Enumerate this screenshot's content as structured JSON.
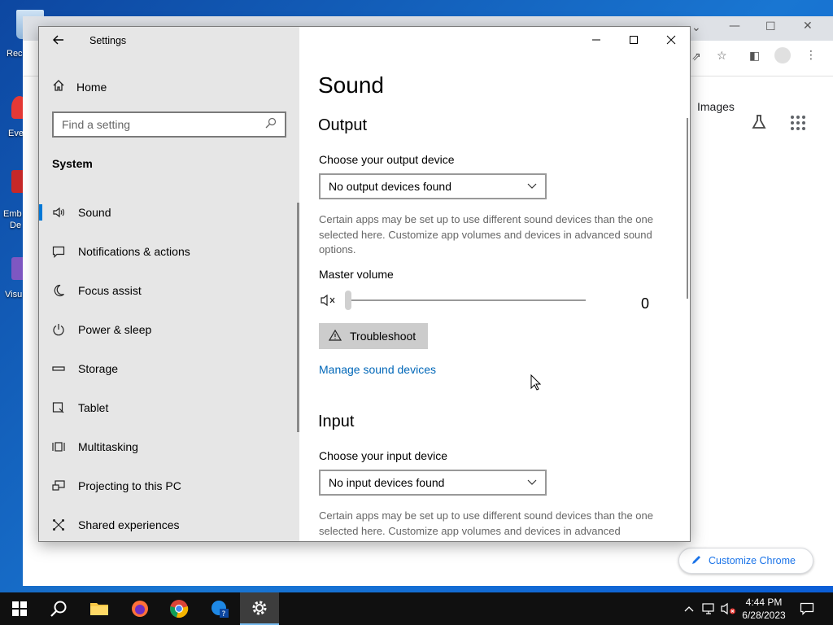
{
  "desktop": {
    "icons": [
      {
        "label": "Rec",
        "color": "#9ec5e8"
      },
      {
        "label": "Eve",
        "color": "#e53935"
      },
      {
        "label": "Emb",
        "label2": "De",
        "color": "#c62828"
      },
      {
        "label": "Visu",
        "color": "#7e57c2"
      }
    ]
  },
  "chrome": {
    "images_label": "Images",
    "customize_label": "Customize Chrome"
  },
  "settings": {
    "window_title": "Settings",
    "sidebar": {
      "home_label": "Home",
      "search_placeholder": "Find a setting",
      "section_label": "System",
      "items": [
        {
          "label": "Sound",
          "icon": "speaker-icon"
        },
        {
          "label": "Notifications & actions",
          "icon": "notification-icon"
        },
        {
          "label": "Focus assist",
          "icon": "moon-icon"
        },
        {
          "label": "Power & sleep",
          "icon": "power-icon"
        },
        {
          "label": "Storage",
          "icon": "storage-icon"
        },
        {
          "label": "Tablet",
          "icon": "tablet-icon"
        },
        {
          "label": "Multitasking",
          "icon": "multitasking-icon"
        },
        {
          "label": "Projecting to this PC",
          "icon": "projecting-icon"
        },
        {
          "label": "Shared experiences",
          "icon": "shared-experiences-icon"
        }
      ]
    },
    "main": {
      "title": "Sound",
      "output": {
        "heading": "Output",
        "device_label": "Choose your output device",
        "device_value": "No output devices found",
        "help": "Certain apps may be set up to use different sound devices than the one selected here. Customize app volumes and devices in advanced sound options.",
        "master_volume_label": "Master volume",
        "volume_value": "0",
        "volume_level": 0,
        "troubleshoot_label": "Troubleshoot",
        "manage_link": "Manage sound devices"
      },
      "input": {
        "heading": "Input",
        "device_label": "Choose your input device",
        "device_value": "No input devices found",
        "help": "Certain apps may be set up to use different sound devices than the one selected here. Customize app volumes and devices in advanced"
      }
    }
  },
  "taskbar": {
    "time": "4:44 PM",
    "date": "6/28/2023"
  },
  "colors": {
    "accent": "#0078d7",
    "link": "#0067b8",
    "taskbar": "#101010"
  }
}
